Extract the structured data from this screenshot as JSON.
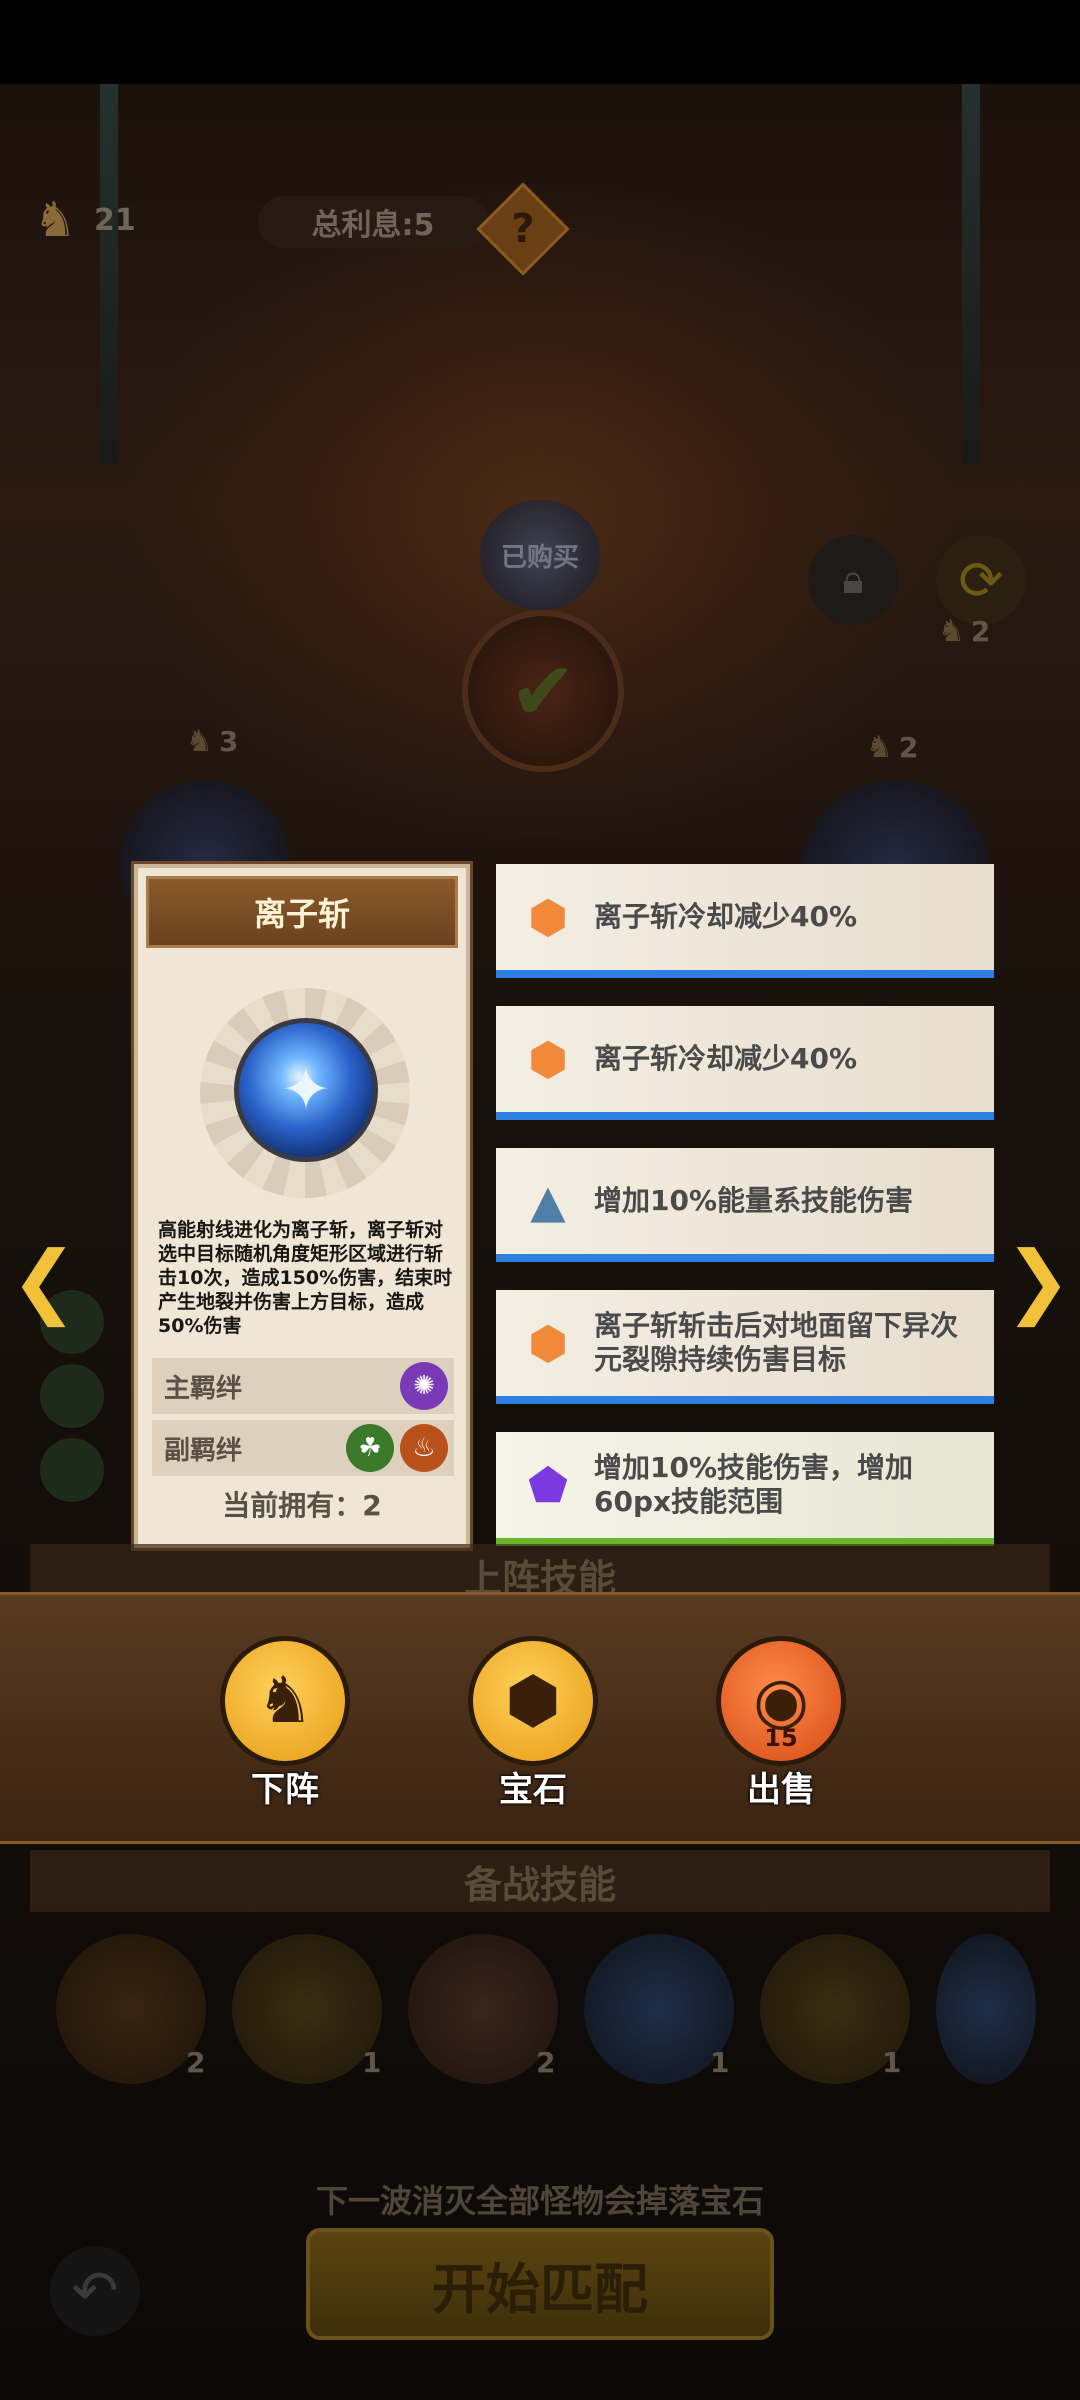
{
  "hud": {
    "coins": "21",
    "interest": "总利息:5",
    "help": "?"
  },
  "arena": {
    "bought_label": "已购买",
    "refresh_cost": "2",
    "left_cost": "3",
    "right_cost": "2"
  },
  "skill_card": {
    "title": "离子斩",
    "description": "高能射线进化为离子斩，离子斩对选中目标随机角度矩形区域进行斩击10次，造成150%伤害，结束时产生地裂并伤害上方目标，造成50%伤害",
    "main_bond_label": "主羁绊",
    "sub_bond_label": "副羁绊",
    "owned": "当前拥有：2"
  },
  "gems": [
    {
      "text": "离子斩冷却减少40%",
      "icon": "orange-hexagon-gem",
      "color": "#f08a3a"
    },
    {
      "text": "离子斩冷却减少40%",
      "icon": "orange-hexagon-gem",
      "color": "#f08a3a"
    },
    {
      "text": "增加10%能量系技能伤害",
      "icon": "blue-triangle-gem",
      "color": "#4f7fa6"
    },
    {
      "text": "离子斩斩击后对地面留下异次元裂隙持续伤害目标",
      "icon": "orange-hexagon-gem",
      "color": "#f08a3a"
    },
    {
      "text": "增加10%技能伤害，增加60px技能范围",
      "icon": "purple-pentagon-gem",
      "color": "#7a3ae0"
    }
  ],
  "actions": {
    "unequip": "下阵",
    "gem": "宝石",
    "sell": "出售",
    "sell_price": "15"
  },
  "sections": {
    "equipped": "上阵技能",
    "reserve": "备战技能"
  },
  "reserve_counts": [
    "2",
    "1",
    "2",
    "1",
    "1"
  ],
  "bottom": {
    "tip": "下一波消灭全部怪物会掉落宝石",
    "match_button": "开始匹配"
  }
}
